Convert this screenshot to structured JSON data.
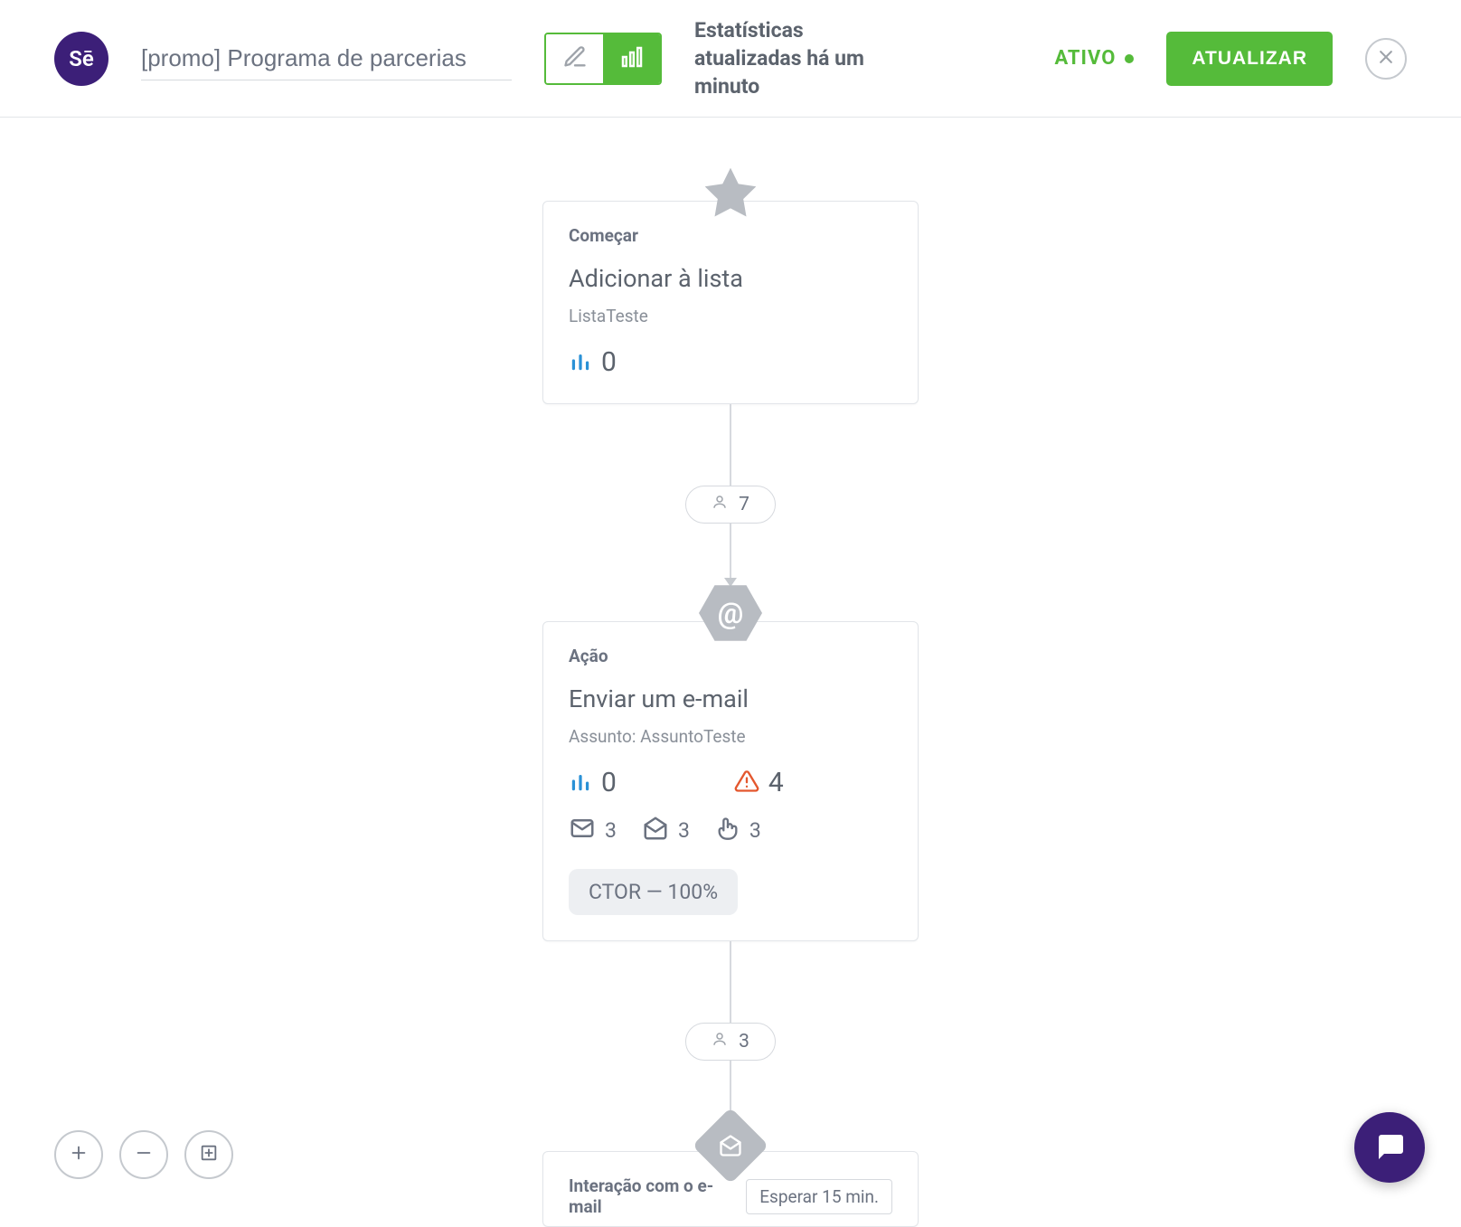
{
  "header": {
    "logo_text": "Sē",
    "title": "[promo] Programa de parcerias",
    "stats_text": "Estatísticas atualizadas há um minuto",
    "status_label": "ATIVO",
    "update_button": "ATUALIZAR"
  },
  "flow": {
    "node1": {
      "type": "Começar",
      "title": "Adicionar à lista",
      "subtitle": "ListaTeste",
      "in_flow": "0"
    },
    "conn1_count": "7",
    "node2": {
      "type": "Ação",
      "title": "Enviar um e-mail",
      "subtitle": "Assunto: AssuntoTeste",
      "in_flow": "0",
      "errors": "4",
      "sent": "3",
      "opened": "3",
      "clicked": "3",
      "ctor": "CTOR — 100%"
    },
    "conn2_count": "3",
    "node3": {
      "type": "Interação com o e-mail",
      "wait": "Esperar 15 min."
    }
  }
}
